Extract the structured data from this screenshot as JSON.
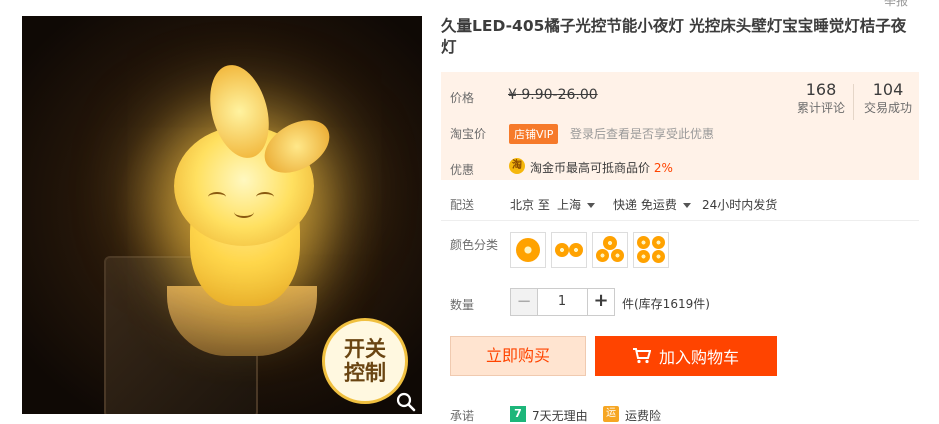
{
  "top_cut_text": "举报",
  "image_badge": {
    "line1": "开关",
    "line2": "控制"
  },
  "title": "久量LED-405橘子光控节能小夜灯 光控床头壁灯宝宝睡觉灯桔子夜灯",
  "price": {
    "label": "价格",
    "symbol": "¥",
    "range": "9.90-26.00",
    "reviews_count": "168",
    "reviews_label": "累计评论",
    "trades_count": "104",
    "trades_label": "交易成功"
  },
  "taobao_price": {
    "label": "淘宝价",
    "badge": "店铺VIP",
    "hint": "登录后查看是否享受此优惠"
  },
  "promo": {
    "label": "优惠",
    "icon": "淘",
    "text": "淘金币最高可抵商品价",
    "percent": "2%"
  },
  "delivery": {
    "label": "配送",
    "from": "北京 至",
    "to": "上海",
    "method": "快递 免运费",
    "ship_time": "24小时内发货"
  },
  "color": {
    "label": "颜色分类",
    "swatch_count": 4
  },
  "quantity": {
    "label": "数量",
    "minus": "−",
    "value": "1",
    "plus": "+",
    "stock": "件(库存1619件)"
  },
  "buttons": {
    "buy_now": "立即购买",
    "add_cart": "加入购物车"
  },
  "promise": {
    "label": "承诺",
    "item1_icon": "7",
    "item1": "7天无理由",
    "item2_icon": "运",
    "item2": "运费险"
  },
  "colors": {
    "accent": "#ff4400",
    "panel_bg": "#fff2e8",
    "vip": "#f67a2a",
    "promise_green": "#1db67a"
  }
}
